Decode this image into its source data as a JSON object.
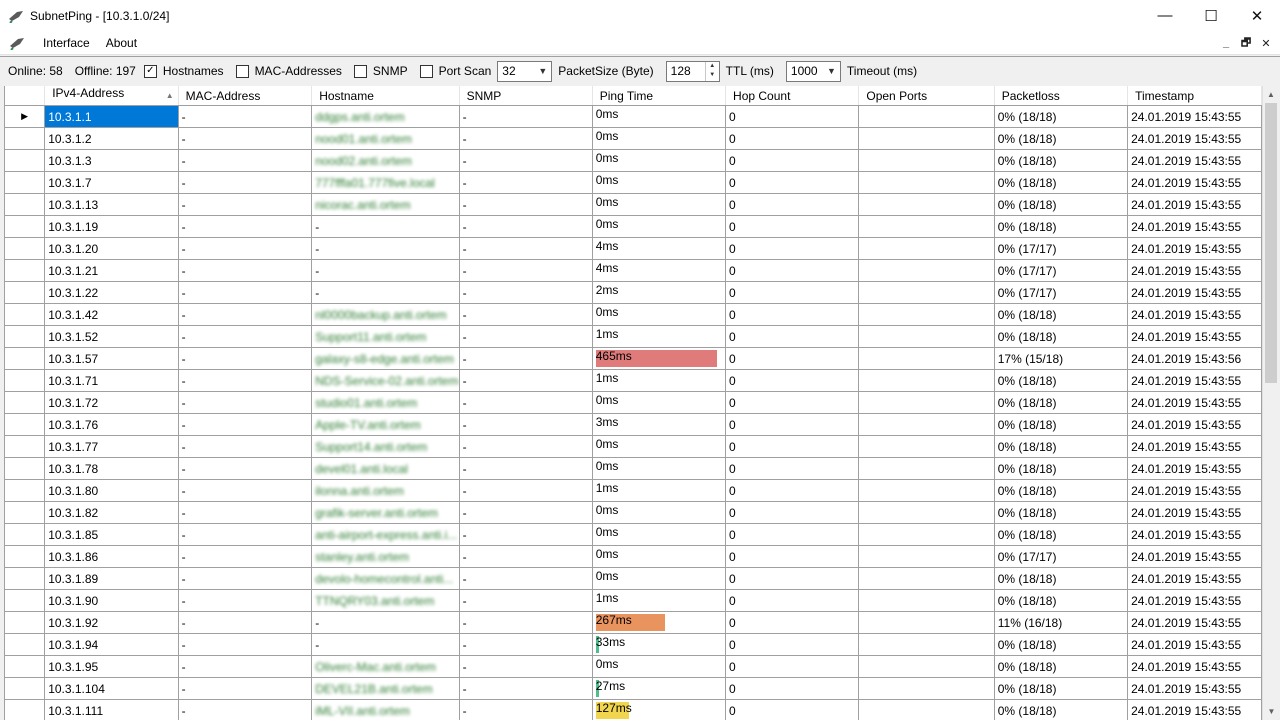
{
  "window": {
    "title": "SubnetPing - [10.3.1.0/24]",
    "controls": {
      "minimize": "—",
      "maximize": "☐",
      "close": "✕"
    }
  },
  "menu": {
    "items": [
      "Interface",
      "About"
    ],
    "mdi": {
      "minimize": "_",
      "restore": "🗗",
      "close": "✕"
    }
  },
  "toolbar": {
    "online": "Online: 58",
    "offline": "Offline: 197",
    "hostnames": {
      "label": "Hostnames",
      "checked": true
    },
    "mac": {
      "label": "MAC-Addresses",
      "checked": false
    },
    "snmp": {
      "label": "SNMP",
      "checked": false
    },
    "portscan": {
      "label": "Port Scan",
      "checked": false
    },
    "packetsize_value": "32",
    "packetsize_label": "PacketSize (Byte)",
    "ttl_value": "128",
    "ttl_label": "TTL (ms)",
    "timeout_value": "1000",
    "timeout_label": "Timeout (ms)"
  },
  "table": {
    "columns": [
      "IPv4-Address",
      "MAC-Address",
      "Hostname",
      "SNMP",
      "Ping Time",
      "Hop Count",
      "Open Ports",
      "Packetloss",
      "Timestamp"
    ],
    "rows": [
      {
        "ip": "10.3.1.1",
        "mac": "-",
        "host": "ddgps.anti.ortem",
        "snmp": "-",
        "ping": "0ms",
        "ping_value": 0,
        "hop": "0",
        "ports": "",
        "loss": "0% (18/18)",
        "time": "24.01.2019 15:43:55"
      },
      {
        "ip": "10.3.1.2",
        "mac": "-",
        "host": "nood01.anti.ortem",
        "snmp": "-",
        "ping": "0ms",
        "ping_value": 0,
        "hop": "0",
        "ports": "",
        "loss": "0% (18/18)",
        "time": "24.01.2019 15:43:55"
      },
      {
        "ip": "10.3.1.3",
        "mac": "-",
        "host": "nood02.anti.ortem",
        "snmp": "-",
        "ping": "0ms",
        "ping_value": 0,
        "hop": "0",
        "ports": "",
        "loss": "0% (18/18)",
        "time": "24.01.2019 15:43:55"
      },
      {
        "ip": "10.3.1.7",
        "mac": "-",
        "host": "777fffa01.777five.local",
        "snmp": "-",
        "ping": "0ms",
        "ping_value": 0,
        "hop": "0",
        "ports": "",
        "loss": "0% (18/18)",
        "time": "24.01.2019 15:43:55"
      },
      {
        "ip": "10.3.1.13",
        "mac": "-",
        "host": "nicorac.anti.ortem",
        "snmp": "-",
        "ping": "0ms",
        "ping_value": 0,
        "hop": "0",
        "ports": "",
        "loss": "0% (18/18)",
        "time": "24.01.2019 15:43:55"
      },
      {
        "ip": "10.3.1.19",
        "mac": "-",
        "host": "-",
        "snmp": "-",
        "ping": "0ms",
        "ping_value": 0,
        "hop": "0",
        "ports": "",
        "loss": "0% (18/18)",
        "time": "24.01.2019 15:43:55"
      },
      {
        "ip": "10.3.1.20",
        "mac": "-",
        "host": "-",
        "snmp": "-",
        "ping": "4ms",
        "ping_value": 4,
        "hop": "0",
        "ports": "",
        "loss": "0% (17/17)",
        "time": "24.01.2019 15:43:55"
      },
      {
        "ip": "10.3.1.21",
        "mac": "-",
        "host": "-",
        "snmp": "-",
        "ping": "4ms",
        "ping_value": 4,
        "hop": "0",
        "ports": "",
        "loss": "0% (17/17)",
        "time": "24.01.2019 15:43:55"
      },
      {
        "ip": "10.3.1.22",
        "mac": "-",
        "host": "-",
        "snmp": "-",
        "ping": "2ms",
        "ping_value": 2,
        "hop": "0",
        "ports": "",
        "loss": "0% (17/17)",
        "time": "24.01.2019 15:43:55"
      },
      {
        "ip": "10.3.1.42",
        "mac": "-",
        "host": "nl0000backup.anti.ortem",
        "snmp": "-",
        "ping": "0ms",
        "ping_value": 0,
        "hop": "0",
        "ports": "",
        "loss": "0% (18/18)",
        "time": "24.01.2019 15:43:55"
      },
      {
        "ip": "10.3.1.52",
        "mac": "-",
        "host": "Support11.anti.ortem",
        "snmp": "-",
        "ping": "1ms",
        "ping_value": 1,
        "hop": "0",
        "ports": "",
        "loss": "0% (18/18)",
        "time": "24.01.2019 15:43:55"
      },
      {
        "ip": "10.3.1.57",
        "mac": "-",
        "host": "galaxy-s8-edge.anti.ortem",
        "snmp": "-",
        "ping": "465ms",
        "ping_value": 465,
        "hop": "0",
        "ports": "",
        "loss": "17% (15/18)",
        "time": "24.01.2019 15:43:56"
      },
      {
        "ip": "10.3.1.71",
        "mac": "-",
        "host": "NDS-Service-02.anti.ortem",
        "snmp": "-",
        "ping": "1ms",
        "ping_value": 1,
        "hop": "0",
        "ports": "",
        "loss": "0% (18/18)",
        "time": "24.01.2019 15:43:55"
      },
      {
        "ip": "10.3.1.72",
        "mac": "-",
        "host": "studio01.anti.ortem",
        "snmp": "-",
        "ping": "0ms",
        "ping_value": 0,
        "hop": "0",
        "ports": "",
        "loss": "0% (18/18)",
        "time": "24.01.2019 15:43:55"
      },
      {
        "ip": "10.3.1.76",
        "mac": "-",
        "host": "Apple-TV.anti.ortem",
        "snmp": "-",
        "ping": "3ms",
        "ping_value": 3,
        "hop": "0",
        "ports": "",
        "loss": "0% (18/18)",
        "time": "24.01.2019 15:43:55"
      },
      {
        "ip": "10.3.1.77",
        "mac": "-",
        "host": "Support14.anti.ortem",
        "snmp": "-",
        "ping": "0ms",
        "ping_value": 0,
        "hop": "0",
        "ports": "",
        "loss": "0% (18/18)",
        "time": "24.01.2019 15:43:55"
      },
      {
        "ip": "10.3.1.78",
        "mac": "-",
        "host": "devel01.anti.local",
        "snmp": "-",
        "ping": "0ms",
        "ping_value": 0,
        "hop": "0",
        "ports": "",
        "loss": "0% (18/18)",
        "time": "24.01.2019 15:43:55"
      },
      {
        "ip": "10.3.1.80",
        "mac": "-",
        "host": "ilonna.anti.ortem",
        "snmp": "-",
        "ping": "1ms",
        "ping_value": 1,
        "hop": "0",
        "ports": "",
        "loss": "0% (18/18)",
        "time": "24.01.2019 15:43:55"
      },
      {
        "ip": "10.3.1.82",
        "mac": "-",
        "host": "grafik-server.anti.ortem",
        "snmp": "-",
        "ping": "0ms",
        "ping_value": 0,
        "hop": "0",
        "ports": "",
        "loss": "0% (18/18)",
        "time": "24.01.2019 15:43:55"
      },
      {
        "ip": "10.3.1.85",
        "mac": "-",
        "host": "anti-airport-express.anti.i...",
        "snmp": "-",
        "ping": "0ms",
        "ping_value": 0,
        "hop": "0",
        "ports": "",
        "loss": "0% (18/18)",
        "time": "24.01.2019 15:43:55"
      },
      {
        "ip": "10.3.1.86",
        "mac": "-",
        "host": "stanley.anti.ortem",
        "snmp": "-",
        "ping": "0ms",
        "ping_value": 0,
        "hop": "0",
        "ports": "",
        "loss": "0% (17/17)",
        "time": "24.01.2019 15:43:55"
      },
      {
        "ip": "10.3.1.89",
        "mac": "-",
        "host": "devolo-homecontrol.anti...",
        "snmp": "-",
        "ping": "0ms",
        "ping_value": 0,
        "hop": "0",
        "ports": "",
        "loss": "0% (18/18)",
        "time": "24.01.2019 15:43:55"
      },
      {
        "ip": "10.3.1.90",
        "mac": "-",
        "host": "TTNQRY03.anti.ortem",
        "snmp": "-",
        "ping": "1ms",
        "ping_value": 1,
        "hop": "0",
        "ports": "",
        "loss": "0% (18/18)",
        "time": "24.01.2019 15:43:55"
      },
      {
        "ip": "10.3.1.92",
        "mac": "-",
        "host": "-",
        "snmp": "-",
        "ping": "267ms",
        "ping_value": 267,
        "hop": "0",
        "ports": "",
        "loss": "11% (16/18)",
        "time": "24.01.2019 15:43:55"
      },
      {
        "ip": "10.3.1.94",
        "mac": "-",
        "host": "-",
        "snmp": "-",
        "ping": "33ms",
        "ping_value": 33,
        "hop": "0",
        "ports": "",
        "loss": "0% (18/18)",
        "time": "24.01.2019 15:43:55"
      },
      {
        "ip": "10.3.1.95",
        "mac": "-",
        "host": "Oliverc-Mac.anti.ortem",
        "snmp": "-",
        "ping": "0ms",
        "ping_value": 0,
        "hop": "0",
        "ports": "",
        "loss": "0% (18/18)",
        "time": "24.01.2019 15:43:55"
      },
      {
        "ip": "10.3.1.104",
        "mac": "-",
        "host": "DEVEL21B.anti.ortem",
        "snmp": "-",
        "ping": "27ms",
        "ping_value": 27,
        "hop": "0",
        "ports": "",
        "loss": "0% (18/18)",
        "time": "24.01.2019 15:43:55"
      },
      {
        "ip": "10.3.1.111",
        "mac": "-",
        "host": "iML-VII.anti.ortem",
        "snmp": "-",
        "ping": "127ms",
        "ping_value": 127,
        "hop": "0",
        "ports": "",
        "loss": "0% (18/18)",
        "time": "24.01.2019 15:43:55"
      }
    ]
  },
  "colors": {
    "selection": "#0078d7",
    "ping_high": "#e07b7b",
    "ping_medium": "#e9935f",
    "ping_low": "#f2d54f",
    "ping_min": "#4fc08d",
    "hostname_text": "#2e7d32"
  }
}
